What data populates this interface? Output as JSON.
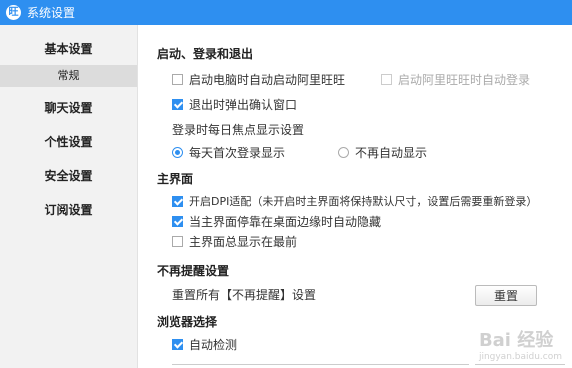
{
  "window": {
    "title": "系统设置",
    "logo_text": "旺"
  },
  "sidebar": {
    "items": [
      {
        "label": "基本设置"
      },
      {
        "label": "常规"
      },
      {
        "label": "聊天设置"
      },
      {
        "label": "个性设置"
      },
      {
        "label": "安全设置"
      },
      {
        "label": "订阅设置"
      }
    ]
  },
  "sections": {
    "startup": {
      "title": "启动、登录和退出",
      "opt_autostart": "启动电脑时自动启动阿里旺旺",
      "opt_autologin": "启动阿里旺旺时自动登录",
      "opt_confirm_exit": "退出时弹出确认窗口",
      "focus_label": "登录时每日焦点显示设置",
      "radio_first_login": "每天首次登录显示",
      "radio_never": "不再自动显示"
    },
    "mainui": {
      "title": "主界面",
      "opt_dpi": "开启DPI适配（未开启时主界面将保持默认尺寸，设置后需要重新登录）",
      "opt_autohide": "当主界面停靠在桌面边缘时自动隐藏",
      "opt_ontop": "主界面总显示在最前"
    },
    "reminder": {
      "title": "不再提醒设置",
      "reset_label": "重置所有【不再提醒】设置",
      "reset_button": "重置"
    },
    "browser": {
      "title": "浏览器选择",
      "opt_autodetect": "自动检测"
    }
  },
  "watermark": {
    "brand": "Bai 经验",
    "url": "jingyan.baidu.com"
  },
  "colors": {
    "accent": "#2e8ff0",
    "sidebar_bg": "#f2f2f2"
  }
}
